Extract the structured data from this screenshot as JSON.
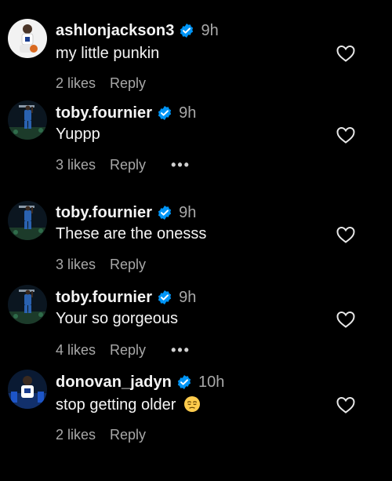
{
  "comments": [
    {
      "username": "ashlonjackson3",
      "time": "9h",
      "text": "my little punkin",
      "likes": "2 likes",
      "reply": "Reply",
      "has_more": false,
      "avatar_icon": "player-avatar-white"
    },
    {
      "username": "toby.fournier",
      "time": "9h",
      "text": "Yuppp",
      "likes": "3 likes",
      "reply": "Reply",
      "has_more": true,
      "more": "•••",
      "avatar_icon": "dunk-avatar"
    },
    {
      "username": "toby.fournier",
      "time": "9h",
      "text": "These are the onesss",
      "likes": "3 likes",
      "reply": "Reply",
      "has_more": false,
      "avatar_icon": "dunk-avatar"
    },
    {
      "username": "toby.fournier",
      "time": "9h",
      "text": "Your so gorgeous",
      "likes": "4 likes",
      "reply": "Reply",
      "has_more": true,
      "more": "•••",
      "avatar_icon": "dunk-avatar"
    },
    {
      "username": "donovan_jadyn",
      "time": "10h",
      "text": "stop getting older",
      "emoji": "pensive-face",
      "likes": "2 likes",
      "reply": "Reply",
      "has_more": false,
      "avatar_icon": "player-avatar-blue"
    }
  ],
  "colors": {
    "background": "#000000",
    "verified": "#0095f6",
    "muted_text": "#a8a8a8",
    "primary_text": "#f5f5f5"
  }
}
